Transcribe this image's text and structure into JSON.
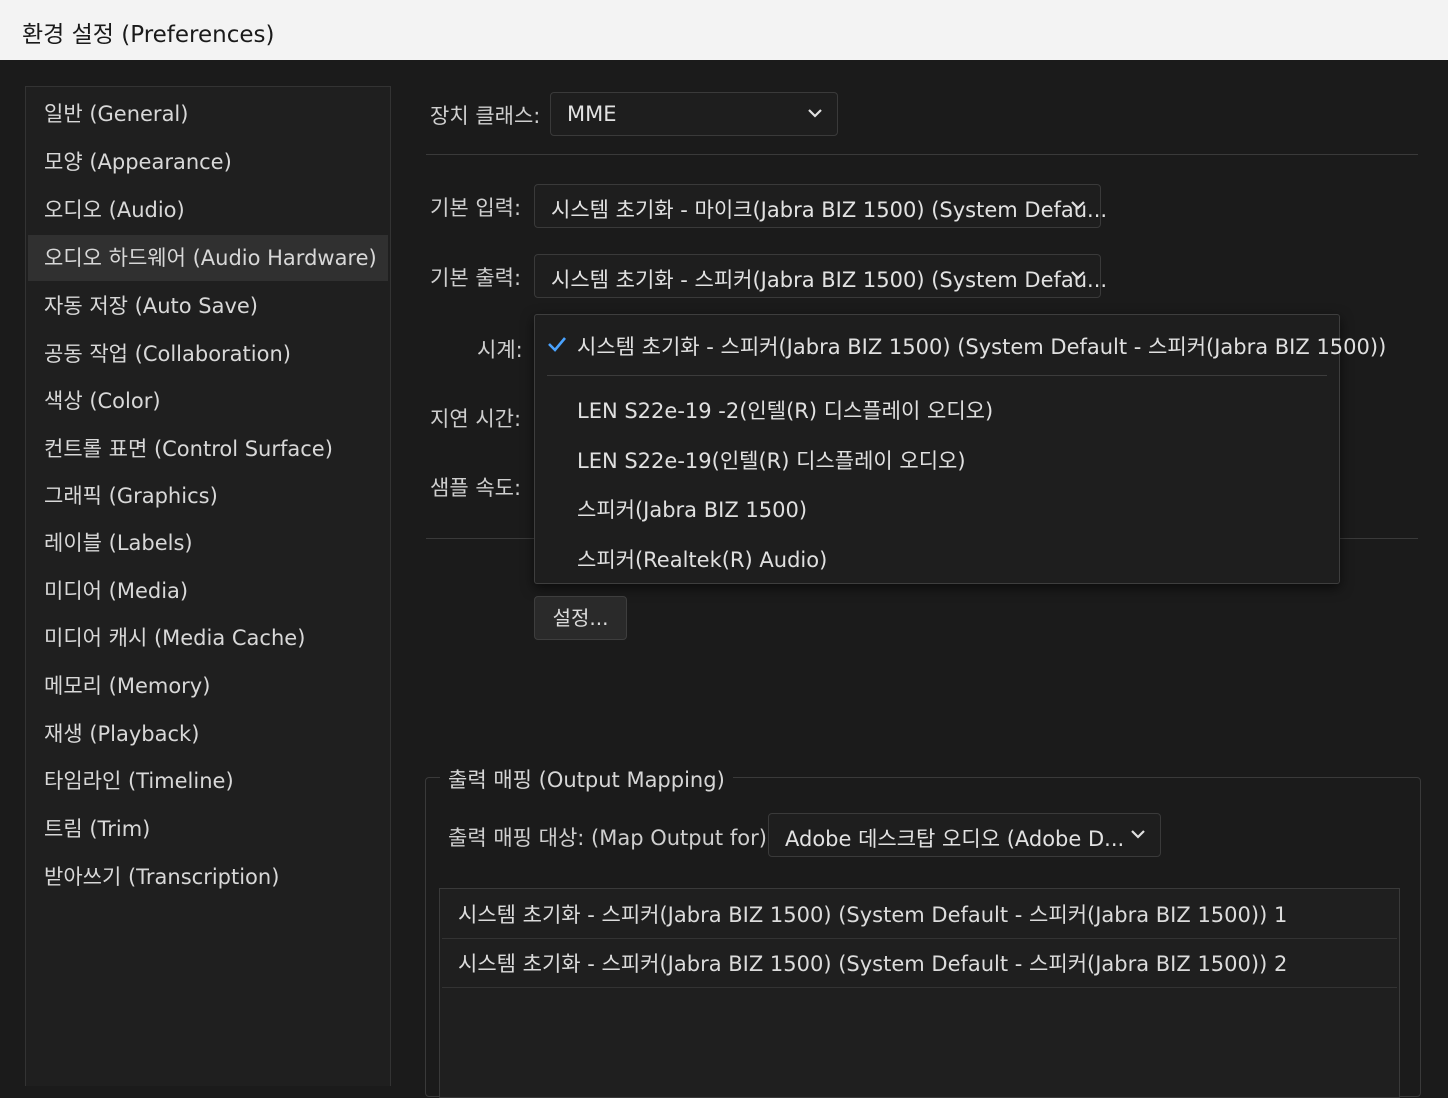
{
  "window": {
    "title": "환경 설정 (Preferences)"
  },
  "sidebar": {
    "items": [
      {
        "label": "일반 (General)"
      },
      {
        "label": "모양 (Appearance)"
      },
      {
        "label": "오디오 (Audio)"
      },
      {
        "label": "오디오 하드웨어 (Audio Hardware)",
        "selected": true
      },
      {
        "label": "자동 저장 (Auto Save)"
      },
      {
        "label": "공동 작업 (Collaboration)"
      },
      {
        "label": "색상 (Color)"
      },
      {
        "label": "컨트롤 표면 (Control Surface)"
      },
      {
        "label": "그래픽 (Graphics)"
      },
      {
        "label": "레이블 (Labels)"
      },
      {
        "label": "미디어 (Media)"
      },
      {
        "label": "미디어 캐시 (Media Cache)"
      },
      {
        "label": "메모리 (Memory)"
      },
      {
        "label": "재생 (Playback)"
      },
      {
        "label": "타임라인 (Timeline)"
      },
      {
        "label": "트림 (Trim)"
      },
      {
        "label": "받아쓰기 (Transcription)"
      }
    ]
  },
  "device_class": {
    "label": "장치 클래스:",
    "value": "MME"
  },
  "default_input": {
    "label": "기본 입력:",
    "value": "시스템 초기화 - 마이크(Jabra BIZ 1500) (System Defau..."
  },
  "default_output": {
    "label": "기본 출력:",
    "value": "시스템 초기화 - 스피커(Jabra BIZ 1500) (System Defau..."
  },
  "clock": {
    "label": "시계:"
  },
  "latency": {
    "label": "지연 시간:"
  },
  "sample_rate": {
    "label": "샘플 속도:"
  },
  "clock_popup": {
    "selected": "시스템 초기화 - 스피커(Jabra BIZ 1500) (System Default - 스피커(Jabra BIZ 1500))",
    "options": [
      "LEN S22e-19 -2(인텔(R) 디스플레이 오디오)",
      "LEN S22e-19(인텔(R) 디스플레이 오디오)",
      "스피커(Jabra BIZ 1500)",
      "스피커(Realtek(R) Audio)"
    ]
  },
  "settings_button": {
    "label": "설정..."
  },
  "output_mapping": {
    "title": "출력 매핑 (Output Mapping)",
    "map_for_label": "출력 매핑 대상: (Map Output for):",
    "map_for_value": "Adobe 데스크탑 오디오 (Adobe D...",
    "rows": [
      "시스템 초기화 - 스피커(Jabra BIZ 1500) (System Default - 스피커(Jabra BIZ 1500)) 1",
      "시스템 초기화 - 스피커(Jabra BIZ 1500) (System Default - 스피커(Jabra BIZ 1500)) 2"
    ]
  },
  "colors": {
    "background": "#1b1b1b",
    "panel": "#1f1f1f",
    "selected": "#303030",
    "accent": "#4aa3ff"
  }
}
